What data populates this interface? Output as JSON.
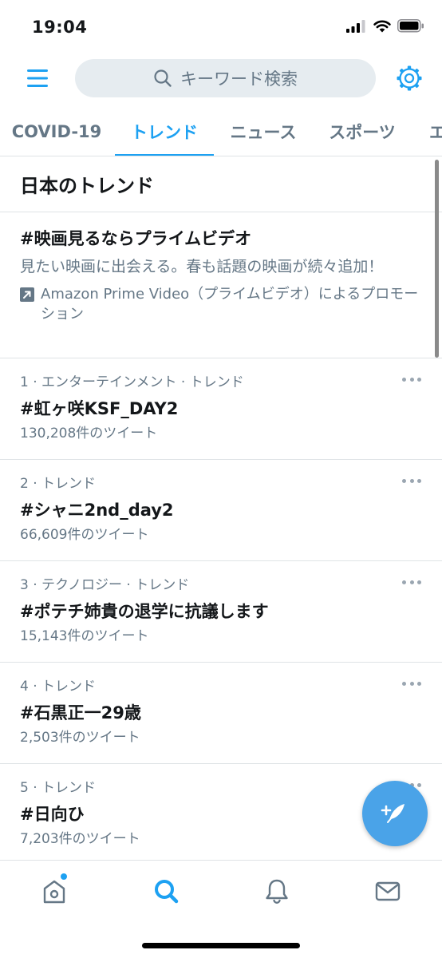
{
  "status_bar": {
    "time": "19:04"
  },
  "search": {
    "placeholder": "キーワード検索"
  },
  "tabs": [
    {
      "label": "COVID-19"
    },
    {
      "label": "トレンド",
      "active": true
    },
    {
      "label": "ニュース"
    },
    {
      "label": "スポーツ"
    },
    {
      "label": "エ"
    }
  ],
  "section": {
    "title": "日本のトレンド"
  },
  "promo": {
    "hashtag": "#映画見るならプライムビデオ",
    "description": "見たい映画に出会える。春も話題の映画が続々追加！",
    "promoted_by": "Amazon Prime Video（プライムビデオ）によるプロモーション"
  },
  "trends": [
    {
      "meta": "1 · エンターテインメント · トレンド",
      "name": "#虹ヶ咲KSF_DAY2",
      "count": "130,208件のツイート"
    },
    {
      "meta": "2 · トレンド",
      "name": "#シャニ2nd_day2",
      "count": "66,609件のツイート"
    },
    {
      "meta": "3 · テクノロジー · トレンド",
      "name": "#ポテチ姉貴の退学に抗議します",
      "count": "15,143件のツイート"
    },
    {
      "meta": "4 · トレンド",
      "name": "#石黒正一29歳",
      "count": "2,503件のツイート"
    },
    {
      "meta": "5 · トレンド",
      "name": "#日向ひ",
      "count": "7,203件のツイート"
    }
  ],
  "colors": {
    "accent": "#1da1f2",
    "secondary_text": "#657786",
    "divider": "#dfe3e6",
    "fab": "#4aa3e8"
  },
  "icons": {
    "menu": "hamburger-menu-icon",
    "search": "search-icon",
    "settings": "gear-icon",
    "promoted": "promoted-arrow-icon",
    "more": "more-dots-icon",
    "compose": "compose-feather-icon",
    "home": "home-icon",
    "explore": "search-icon",
    "notifications": "bell-icon",
    "messages": "envelope-icon"
  }
}
